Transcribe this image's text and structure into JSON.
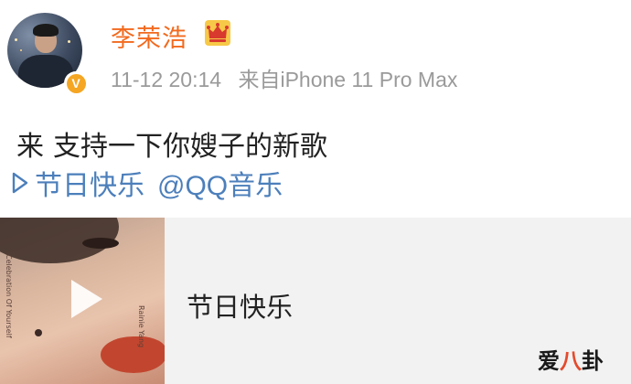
{
  "post": {
    "username": "李荣浩",
    "timestamp": "11-12 20:14",
    "source": "来自iPhone 11 Pro Max",
    "text_part1": "来",
    "text_part2": "支持一下你嫂子的新歌",
    "link_label": "节日快乐",
    "mention": "@QQ音乐"
  },
  "card": {
    "song_title": "节日快乐",
    "cover_title_vertical": "Celebration Of Yourself",
    "cover_artist_vertical": "Rainie Yang"
  },
  "watermark": {
    "left": "爱",
    "mid": "八",
    "right": "卦"
  },
  "colors": {
    "username": "#f26a1e",
    "link": "#4c7fbb",
    "meta": "#9a9a9a",
    "verified": "#f5a623"
  },
  "icons": [
    "crown-icon",
    "verified-icon",
    "play-outline-icon",
    "play-button-icon"
  ]
}
